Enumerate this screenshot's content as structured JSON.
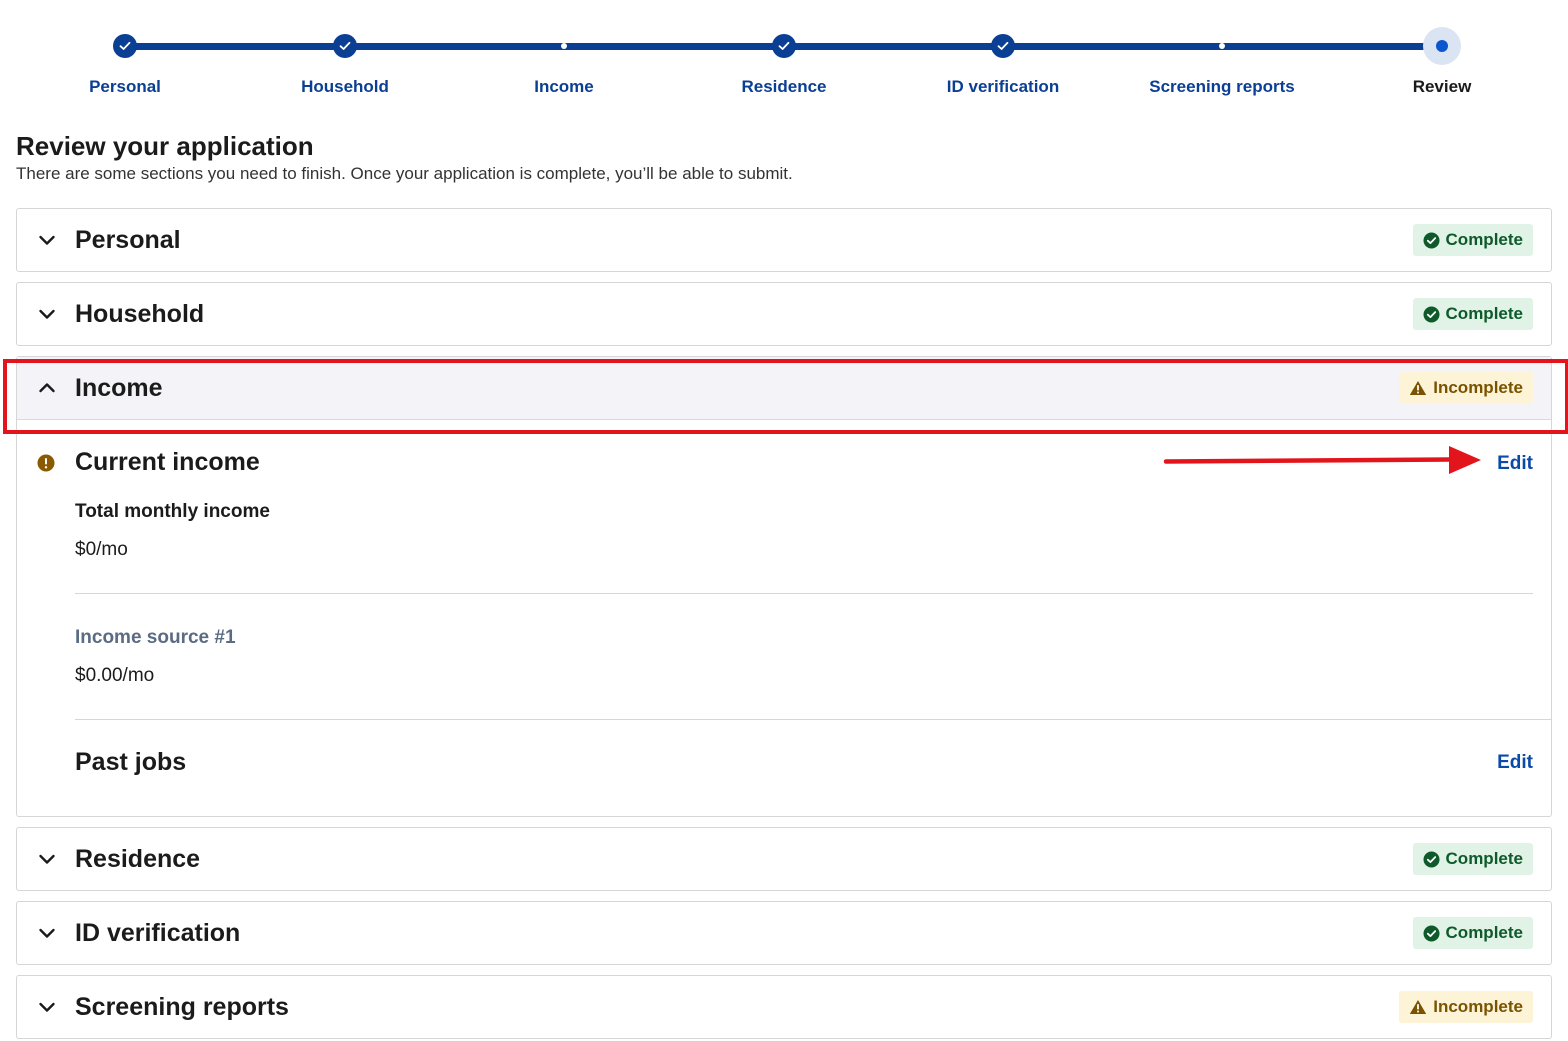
{
  "stepper": {
    "steps": [
      {
        "label": "Personal",
        "state": "done"
      },
      {
        "label": "Household",
        "state": "done"
      },
      {
        "label": "Income",
        "state": "pending"
      },
      {
        "label": "Residence",
        "state": "done"
      },
      {
        "label": "ID verification",
        "state": "done"
      },
      {
        "label": "Screening reports",
        "state": "pending"
      },
      {
        "label": "Review",
        "state": "current"
      }
    ]
  },
  "header": {
    "title": "Review your application",
    "subtitle": "There are some sections you need to finish. Once your application is complete, you’ll be able to submit."
  },
  "sections": [
    {
      "title": "Personal",
      "status": "Complete"
    },
    {
      "title": "Household",
      "status": "Complete"
    },
    {
      "title": "Income",
      "status": "Incomplete",
      "expanded": true,
      "current_income": {
        "title": "Current income",
        "edit_label": "Edit",
        "total_label": "Total monthly income",
        "total_value": "$0/mo",
        "source_label": "Income source #1",
        "source_value": "$0.00/mo"
      },
      "past_jobs": {
        "title": "Past jobs",
        "edit_label": "Edit"
      }
    },
    {
      "title": "Residence",
      "status": "Complete"
    },
    {
      "title": "ID verification",
      "status": "Complete"
    },
    {
      "title": "Screening reports",
      "status": "Incomplete"
    }
  ],
  "colors": {
    "primary": "#0b3f94",
    "link": "#0b4ba8",
    "complete_bg": "#e0f3e6",
    "complete_text": "#0e5a2b",
    "incomplete_bg": "#fdf4d8",
    "incomplete_text": "#7a5200",
    "annotation_red": "#e2151c"
  },
  "icons": {
    "step_done": "checkmark-icon",
    "collapsed": "chevron-down-icon",
    "expanded": "chevron-up-icon",
    "complete": "check-circle-icon",
    "incomplete": "warning-triangle-icon",
    "alert": "exclamation-circle-icon"
  }
}
